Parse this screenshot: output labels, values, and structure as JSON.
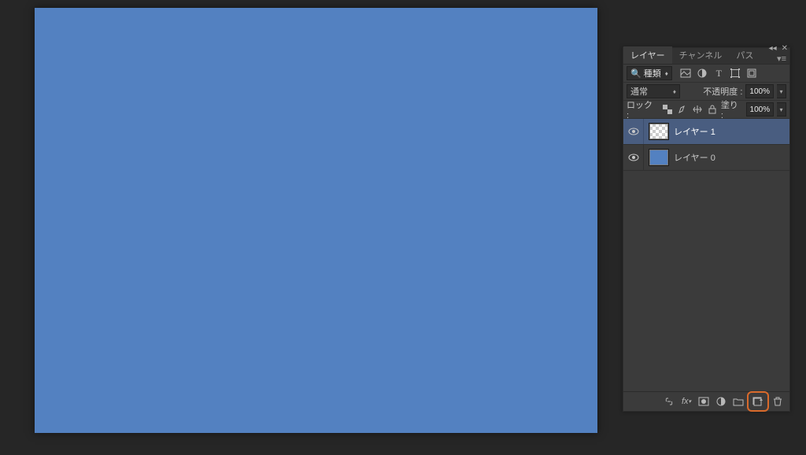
{
  "canvas": {
    "color": "#5381c1"
  },
  "panel": {
    "tabs": {
      "layers": "レイヤー",
      "channels": "チャンネル",
      "paths": "パス"
    },
    "filter": {
      "label": "種類"
    },
    "blend": {
      "mode": "通常",
      "opacity_label": "不透明度 :",
      "opacity_value": "100%"
    },
    "lock": {
      "label": "ロック :",
      "fill_label": "塗り :",
      "fill_value": "100%"
    },
    "layers": [
      {
        "name": "レイヤー 1",
        "visible": true,
        "thumb": "transparent",
        "selected": true
      },
      {
        "name": "レイヤー 0",
        "visible": true,
        "thumb": "color",
        "selected": false
      }
    ]
  }
}
